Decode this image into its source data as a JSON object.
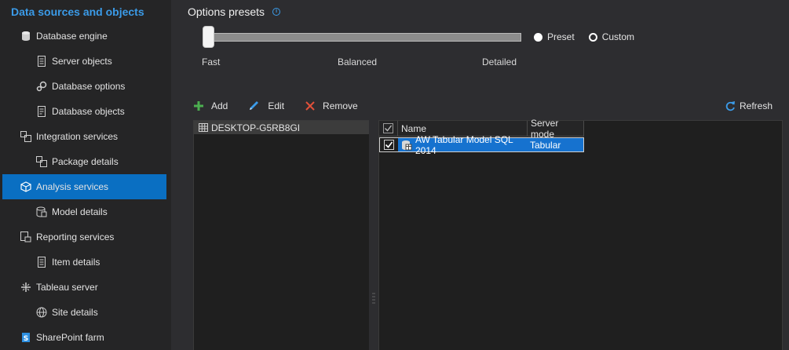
{
  "sidebar": {
    "title": "Data sources and objects",
    "items": [
      {
        "label": "Database engine",
        "icon": "database-icon"
      },
      {
        "label": "Server objects",
        "icon": "document-icon"
      },
      {
        "label": "Database options",
        "icon": "gears-icon"
      },
      {
        "label": "Database objects",
        "icon": "document-icon"
      },
      {
        "label": "Integration services",
        "icon": "package-icon"
      },
      {
        "label": "Package details",
        "icon": "package-icon"
      },
      {
        "label": "Analysis services",
        "icon": "cube-icon"
      },
      {
        "label": "Model details",
        "icon": "model-icon"
      },
      {
        "label": "Reporting services",
        "icon": "report-icon"
      },
      {
        "label": "Item details",
        "icon": "document-icon"
      },
      {
        "label": "Tableau server",
        "icon": "tableau-icon"
      },
      {
        "label": "Site details",
        "icon": "globe-icon"
      },
      {
        "label": "SharePoint farm",
        "icon": "sharepoint-icon"
      }
    ],
    "active_index": 6
  },
  "options": {
    "title": "Options presets",
    "slider": {
      "labels": [
        "Fast",
        "Balanced",
        "Detailed"
      ],
      "value": "Fast"
    },
    "radios": [
      {
        "label": "Preset",
        "selected": true
      },
      {
        "label": "Custom",
        "selected": false
      }
    ]
  },
  "toolbar": {
    "add_label": "Add",
    "edit_label": "Edit",
    "remove_label": "Remove",
    "refresh_label": "Refresh"
  },
  "servers": [
    {
      "name": "DESKTOP-G5RB8GI"
    }
  ],
  "grid": {
    "columns": [
      "Name",
      "Server mode"
    ],
    "rows": [
      {
        "checked": true,
        "name": "AW Tabular Model SQL 2014",
        "mode": "Tabular"
      }
    ]
  },
  "colors": {
    "accent": "#0a6fc2",
    "title_blue": "#3b9be8",
    "add_green": "#4caf50",
    "remove_red": "#e0503a"
  }
}
